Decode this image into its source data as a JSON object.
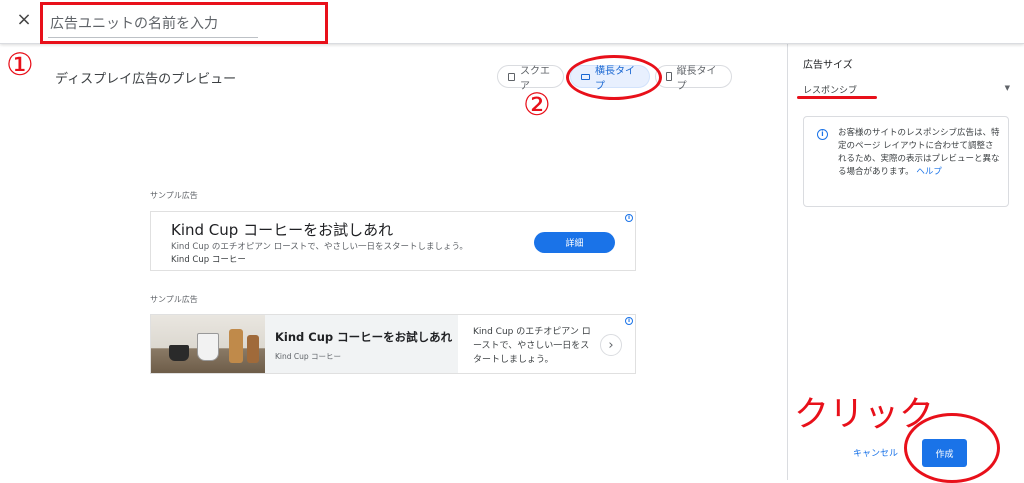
{
  "header": {
    "close_icon": "×",
    "name_placeholder": "広告ユニットの名前を入力"
  },
  "preview": {
    "title": "ディスプレイ広告のプレビュー",
    "shapes": [
      {
        "label": "スクエア",
        "icon": "square-icon",
        "active": false
      },
      {
        "label": "横長タイプ",
        "icon": "landscape-icon",
        "active": true
      },
      {
        "label": "縦長タイプ",
        "icon": "portrait-icon",
        "active": false
      }
    ]
  },
  "ads": [
    {
      "sample_label": "サンプル広告",
      "headline": "Kind Cup コーヒーをお試しあれ",
      "description": "Kind Cup のエチオピアン ローストで、やさしい一日をスタートしましょう。",
      "business": "Kind Cup コーヒー",
      "cta": "詳細"
    },
    {
      "sample_label": "サンプル広告",
      "headline": "Kind Cup コーヒーをお試しあれ",
      "business": "Kind Cup コーヒー",
      "description": "Kind Cup のエチオピアン ローストで、やさしい一日をスタートしましょう。",
      "arrow": "›"
    }
  ],
  "sidebar": {
    "title": "広告サイズ",
    "size_value": "レスポンシブ",
    "caret": "▼",
    "info_text": "お客様のサイトのレスポンシブ広告は、特定のページ レイアウトに合わせて調整されるため、実際の表示はプレビューと異なる場合があります。",
    "help_link": "ヘルプ"
  },
  "footer": {
    "cancel": "キャンセル",
    "create": "作成"
  },
  "annotations": {
    "step1": "①",
    "step2": "②",
    "click": "クリック"
  },
  "colors": {
    "accent": "#1a73e8",
    "annotation": "#e8101a"
  }
}
